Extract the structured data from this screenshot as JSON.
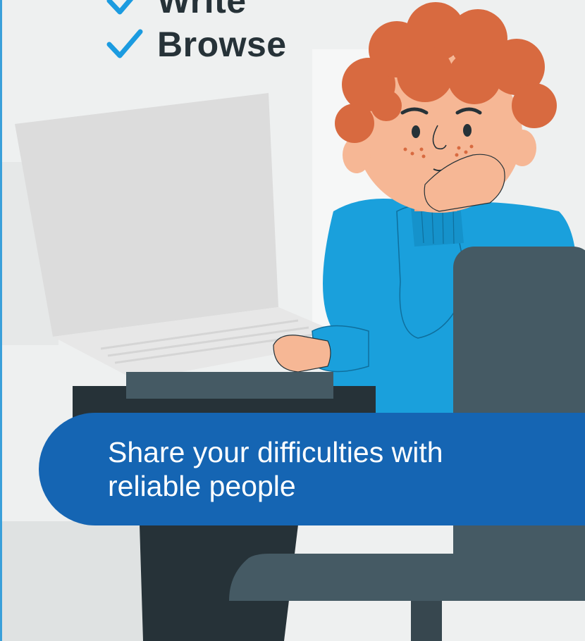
{
  "checklist": {
    "items": [
      {
        "label": "Write",
        "icon": "checkmark-icon"
      },
      {
        "label": "Browse",
        "icon": "checkmark-icon"
      }
    ],
    "check_color": "#1b9be0"
  },
  "banner": {
    "text_line1": "Share your difficulties with",
    "text_line2": "reliable people",
    "background": "#1565b3"
  },
  "illustration": {
    "subject": "boy-with-laptop-illustration",
    "colors": {
      "hair": "#d86a40",
      "skin": "#f6b795",
      "sweater": "#1aa0dc",
      "chair": "#455a64",
      "desk": "#263238"
    }
  }
}
